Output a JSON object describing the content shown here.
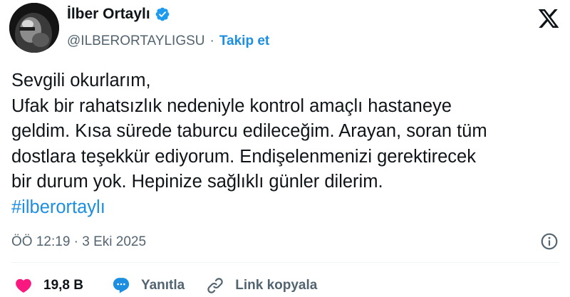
{
  "author": {
    "name": "İlber Ortaylı",
    "handle": "@ILBERORTAYLIGSU",
    "separator": "·",
    "follow_label": "Takip et",
    "verified_icon": "verified-badge-icon"
  },
  "brand": {
    "logo_icon": "x-logo-icon"
  },
  "tweet": {
    "lines": [
      "Sevgili okurlarım,",
      "Ufak bir rahatsızlık nedeniyle kontrol amaçlı hastaneye",
      "geldim. Kısa sürede taburcu edileceğim. Arayan, soran tüm",
      "dostlara teşekkür ediyorum. Endişelenmenizi gerektirecek",
      "bir durum yok. Hepinize sağlıklı günler dilerim."
    ],
    "hashtag": "#ilberortaylı",
    "timestamp": "ÖÖ 12:19 · 3 Eki 2025"
  },
  "actions": {
    "like_count": "19,8 B",
    "reply_label": "Yanıtla",
    "copy_label": "Link kopyala"
  },
  "colors": {
    "accent": "#1d8fe1",
    "like": "#f91880",
    "muted": "#536471",
    "text": "#0f1419"
  }
}
